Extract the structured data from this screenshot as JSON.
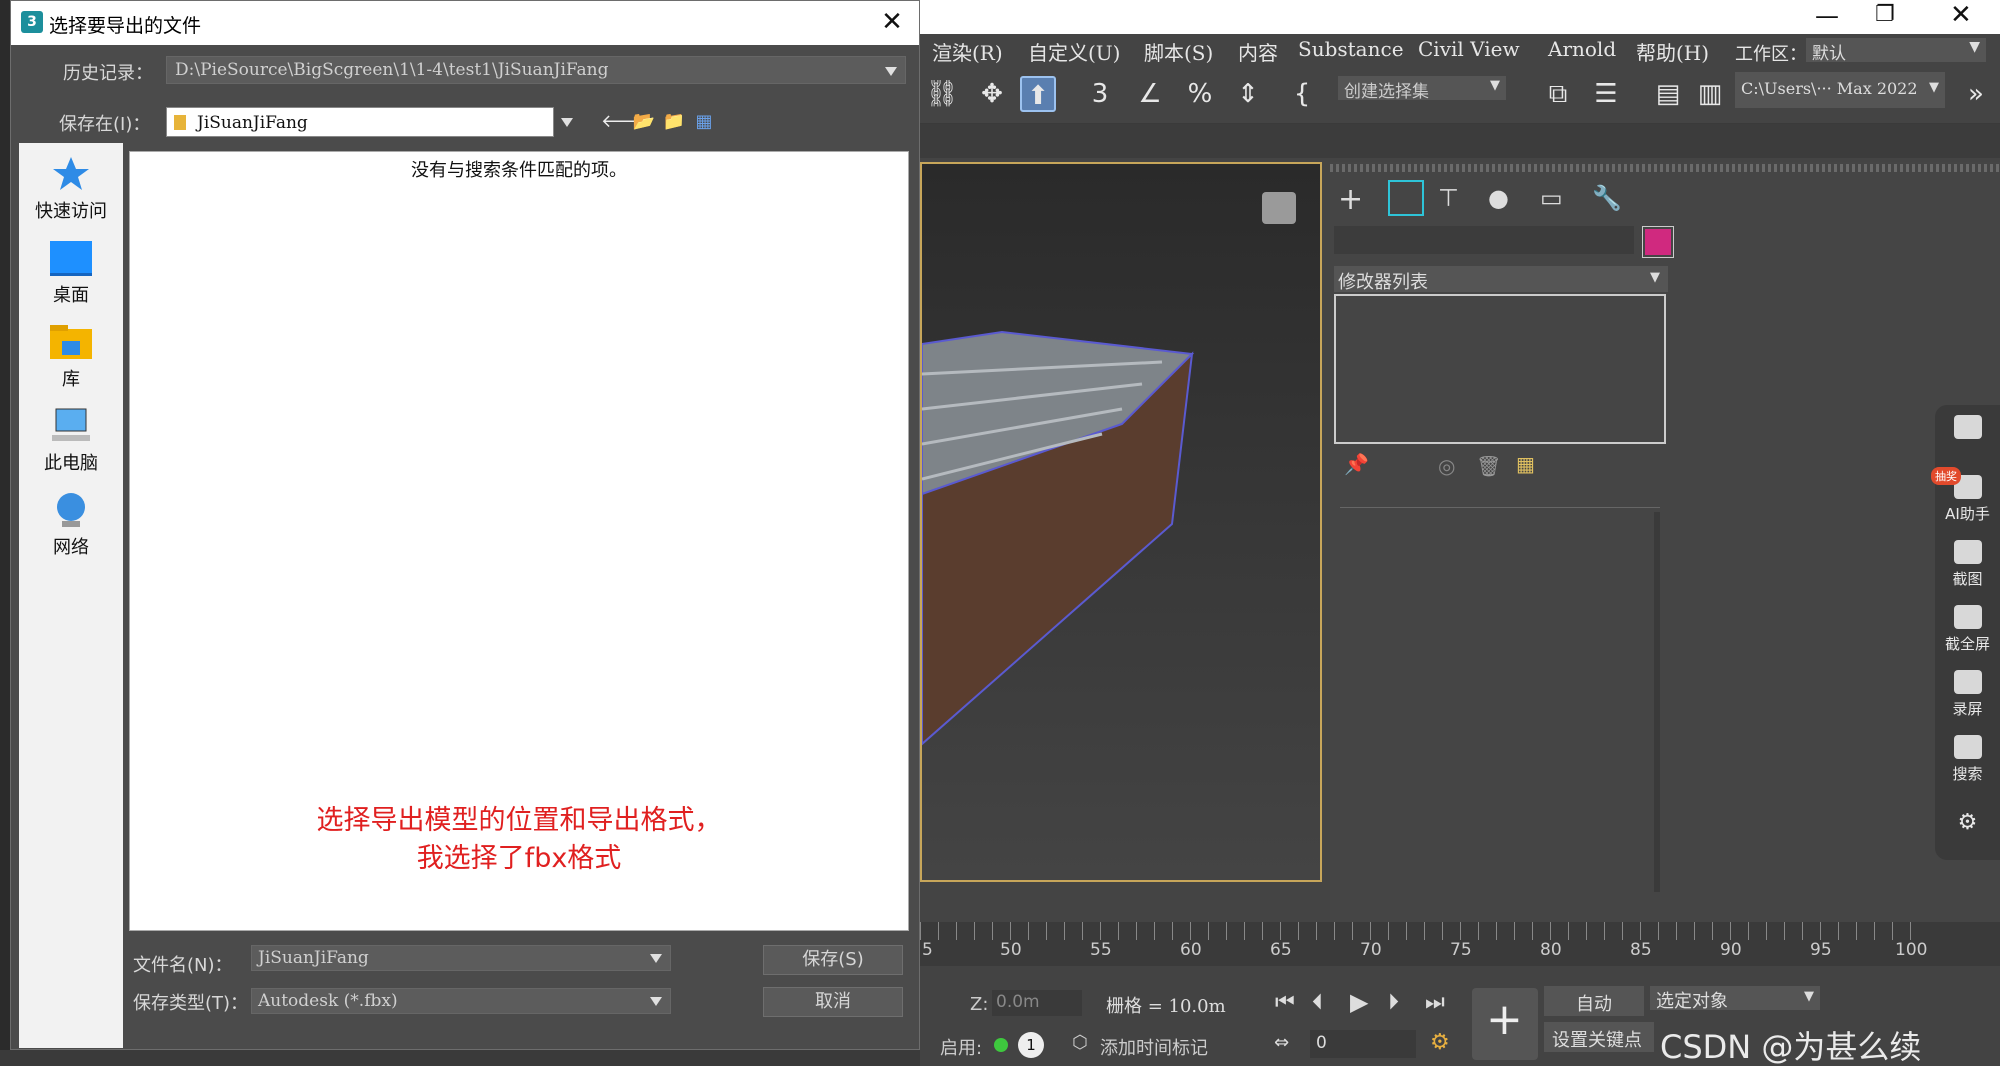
{
  "dialog": {
    "title": "选择要导出的文件",
    "app_icon": "3",
    "close_glyph": "✕",
    "history_label": "历史记录：",
    "history_value": "D:\\PieSource\\BigScgreen\\1\\1-4\\test1\\JiSuanJiFang",
    "save_in_label": "保存在(I)：",
    "save_in_value": "JiSuanJiFang",
    "places": [
      {
        "label": "快速访问",
        "icon": "star-icon"
      },
      {
        "label": "桌面",
        "icon": "desktop-icon"
      },
      {
        "label": "库",
        "icon": "library-icon"
      },
      {
        "label": "此电脑",
        "icon": "computer-icon"
      },
      {
        "label": "网络",
        "icon": "network-icon"
      }
    ],
    "empty_message": "没有与搜索条件匹配的项。",
    "annotation_line1": "选择导出模型的位置和导出格式，",
    "annotation_line2": "我选择了fbx格式",
    "filename_label": "文件名(N)：",
    "filename_value": "JiSuanJiFang",
    "filetype_label": "保存类型(T)：",
    "filetype_value": "Autodesk (*.fbx)",
    "save_button": "保存(S)",
    "cancel_button": "取消"
  },
  "max": {
    "menus": [
      "渲染(R)",
      "自定义(U)",
      "脚本(S)",
      "内容",
      "Substance",
      "Civil View",
      "Arnold",
      "帮助(H)"
    ],
    "workspace_label": "工作区：",
    "workspace_value": "默认",
    "selection_set_placeholder": "创建选择集",
    "path_value": "C:\\Users\\··· Max 2022",
    "modifier_list": "修改器列表",
    "accent_color": "#d0297f",
    "timeline_ticks": [
      "5",
      "50",
      "55",
      "60",
      "65",
      "70",
      "75",
      "80",
      "85",
      "90",
      "95",
      "100"
    ],
    "z_label": "Z:",
    "z_value": "0.0m",
    "grid_text": "栅格 = 10.0m",
    "auto_button": "自动",
    "selected_object": "选定对象",
    "set_key_button": "设置关键点",
    "enable_label": "启用:",
    "add_time_tag": "添加时间标记",
    "frame_value": "0",
    "frame_badge": "1"
  },
  "helper": {
    "items": [
      "AI助手",
      "截图",
      "截全屏",
      "录屏",
      "搜索"
    ],
    "ai_badge": "抽奖"
  },
  "watermark": "CSDN @为甚么续"
}
